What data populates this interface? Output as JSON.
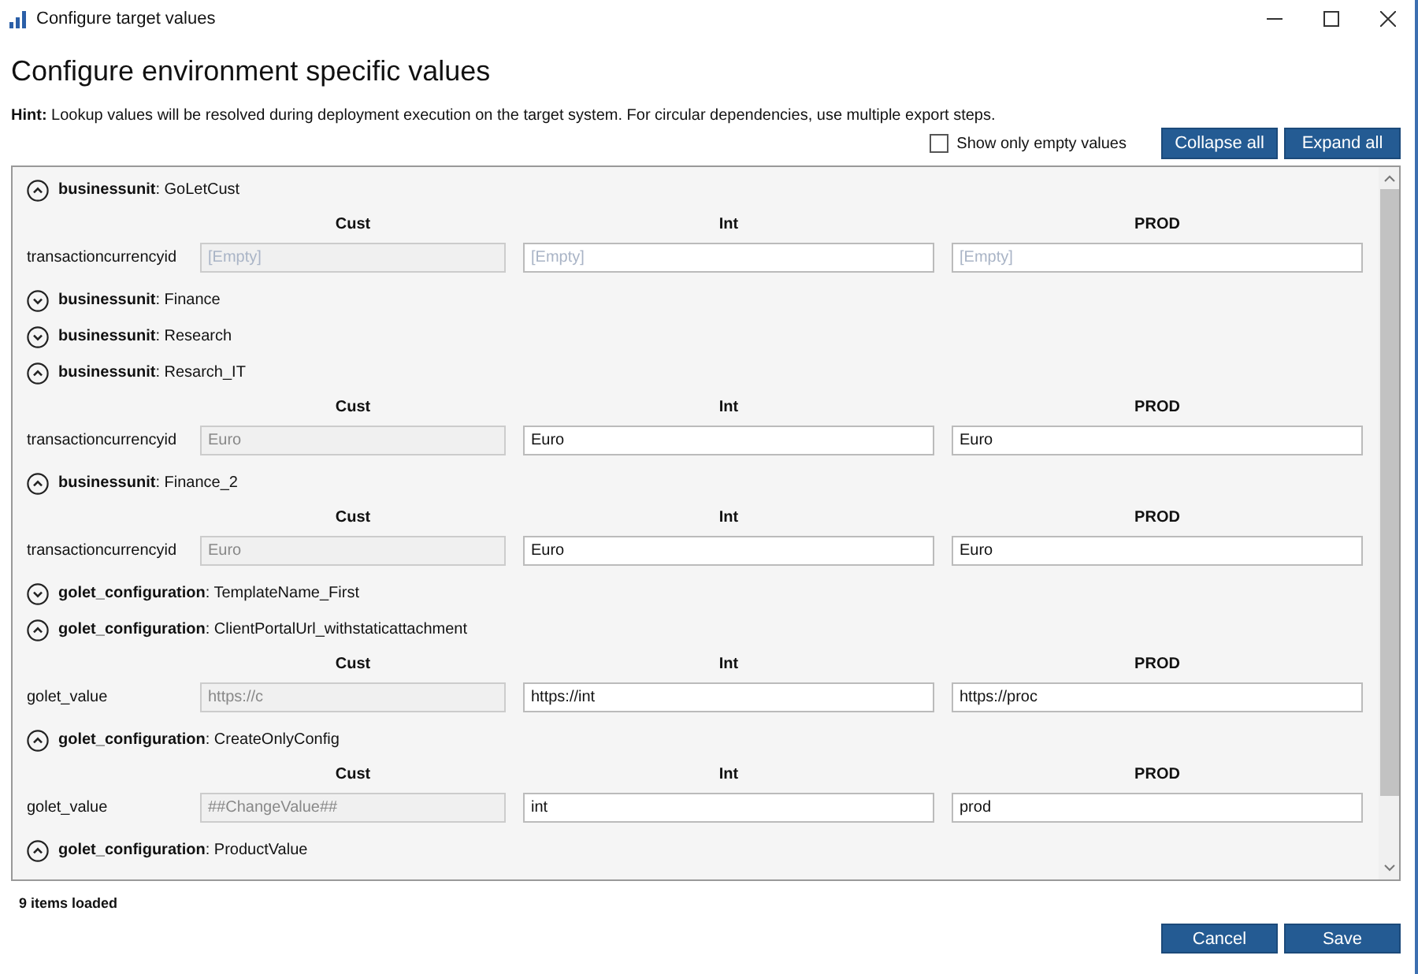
{
  "window": {
    "title": "Configure target values"
  },
  "heading": "Configure environment specific values",
  "hint": "**Hint:** Lookup values will be resolved during deployment execution on the target system. For circular dependencies, use multiple export steps.",
  "filter": {
    "label": "Show only empty values",
    "checked": false
  },
  "toolbar_buttons": [
    "Collapse all",
    "Expand all"
  ],
  "groups": [
    {
      "title": "**businessunit**: GoLetCust",
      "expanded": true,
      "columns": [
        "Cust",
        "Int",
        "PROD"
      ],
      "rows": [
        {
          "label": "transactioncurrencyid",
          "cells": [
            {
              "placeholder": "[Empty]",
              "readonly": true
            },
            {
              "placeholder": "[Empty]",
              "readonly": false
            },
            {
              "placeholder": "[Empty]",
              "readonly": false
            }
          ]
        }
      ]
    },
    {
      "title": "**businessunit**: Finance",
      "expanded": false
    },
    {
      "title": "**businessunit**: Research",
      "expanded": false
    },
    {
      "title": "**businessunit**: Resarch_IT",
      "expanded": true,
      "columns": [
        "Cust",
        "Int",
        "PROD"
      ],
      "rows": [
        {
          "label": "transactioncurrencyid",
          "cells": [
            {
              "value": "Euro",
              "readonly": true
            },
            {
              "value": "Euro",
              "readonly": false
            },
            {
              "value": "Euro",
              "readonly": false
            }
          ]
        }
      ]
    },
    {
      "title": "**businessunit**: Finance_2",
      "expanded": true,
      "columns": [
        "Cust",
        "Int",
        "PROD"
      ],
      "rows": [
        {
          "label": "transactioncurrencyid",
          "cells": [
            {
              "value": "Euro",
              "readonly": true
            },
            {
              "value": "Euro",
              "readonly": false
            },
            {
              "value": "Euro",
              "readonly": false
            }
          ]
        }
      ]
    },
    {
      "title": "**golet_configuration**: TemplateName_First",
      "expanded": false
    },
    {
      "title": "**golet_configuration**: ClientPortalUrl_withstaticattachment",
      "expanded": true,
      "columns": [
        "Cust",
        "Int",
        "PROD"
      ],
      "rows": [
        {
          "label": "golet_value",
          "cells": [
            {
              "value": "https://c",
              "readonly": true
            },
            {
              "value": "https://int",
              "readonly": false
            },
            {
              "value": "https://proc",
              "readonly": false
            }
          ]
        }
      ]
    },
    {
      "title": "**golet_configuration**: CreateOnlyConfig",
      "expanded": true,
      "columns": [
        "Cust",
        "Int",
        "PROD"
      ],
      "rows": [
        {
          "label": "golet_value",
          "cells": [
            {
              "value": "##ChangeValue##",
              "readonly": true
            },
            {
              "value": "int",
              "readonly": false
            },
            {
              "value": "prod",
              "readonly": false
            }
          ]
        }
      ]
    },
    {
      "title": "**golet_configuration**: ProductValue",
      "expanded": true
    }
  ],
  "status": "9 items loaded",
  "footer_buttons": [
    "Cancel",
    "Save"
  ]
}
